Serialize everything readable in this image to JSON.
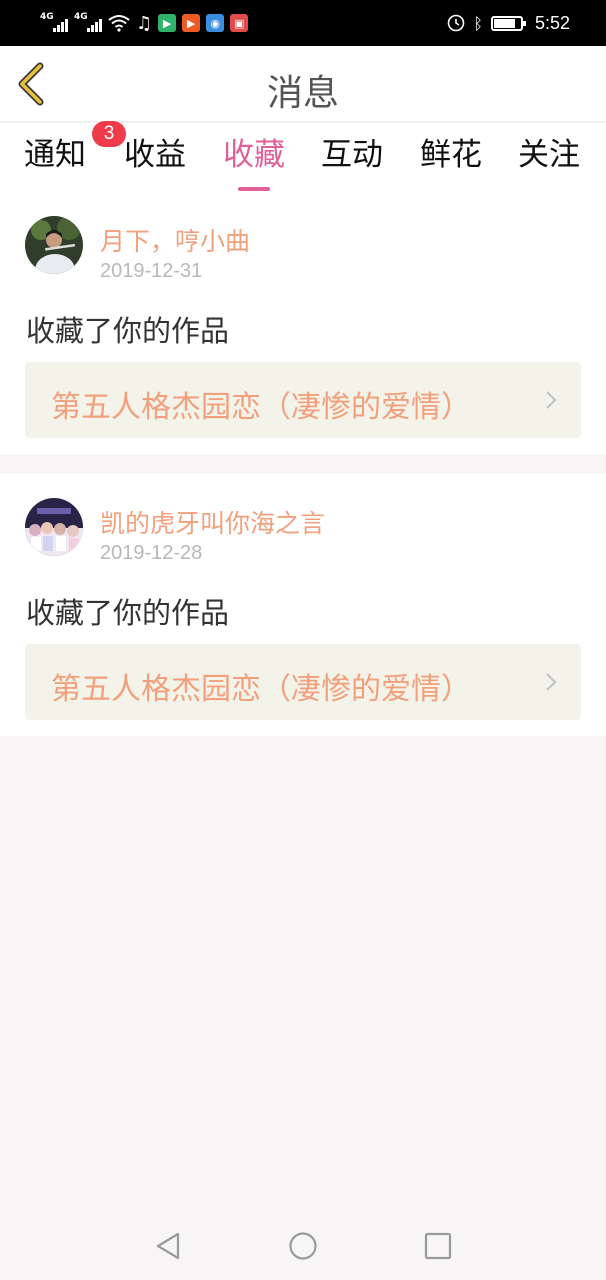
{
  "status_bar": {
    "network_1": "4G",
    "network_2": "4G",
    "time": "5:52",
    "battery_level": 0.8
  },
  "header": {
    "title": "消息"
  },
  "tabs": [
    {
      "label": "通知",
      "badge": "3"
    },
    {
      "label": "收益"
    },
    {
      "label": "收藏",
      "active": true
    },
    {
      "label": "互动"
    },
    {
      "label": "鲜花"
    },
    {
      "label": "关注"
    }
  ],
  "messages": [
    {
      "username": "月下，哼小曲",
      "date": "2019-12-31",
      "action": "收藏了你的作品",
      "work_title": "第五人格杰园恋（凄惨的爱情）"
    },
    {
      "username": "凯的虎牙叫你海之言",
      "date": "2019-12-28",
      "action": "收藏了你的作品",
      "work_title": "第五人格杰园恋（凄惨的爱情）"
    }
  ],
  "colors": {
    "accent": "#e0609a",
    "username": "#f2a07c",
    "badge": "#f03c4a",
    "link_background": "#f4f3ea"
  }
}
